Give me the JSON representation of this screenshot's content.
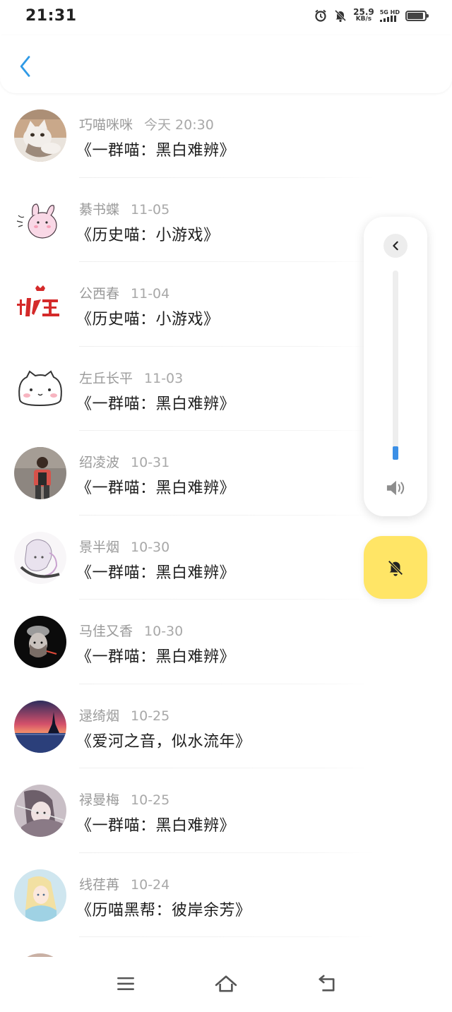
{
  "status_bar": {
    "time": "21:31",
    "net_speed_value": "25.9",
    "net_speed_unit": "KB/s",
    "signal_label": "5G HD",
    "battery_level": 0.9,
    "icons": [
      "alarm-icon",
      "silent-bell-icon",
      "signal-icon",
      "battery-icon"
    ]
  },
  "header": {
    "back_icon": "chevron-left-icon",
    "accent_color": "#2f9ae6"
  },
  "list": {
    "items": [
      {
        "name": "巧喵咪咪",
        "date": "今天 20:30",
        "title": "《一群喵：黑白难辨》",
        "avatar": "cat-photo"
      },
      {
        "name": "綦书蝶",
        "date": "11-05",
        "title": "《历史喵：小游戏》",
        "avatar": "pink-bunny"
      },
      {
        "name": "公西春",
        "date": "11-04",
        "title": "《历史喵：小游戏》",
        "avatar": "red-calligraphy"
      },
      {
        "name": "左丘长平",
        "date": "11-03",
        "title": "《一群喵：黑白难辨》",
        "avatar": "white-cat-cartoon"
      },
      {
        "name": "绍凌波",
        "date": "10-31",
        "title": "《一群喵：黑白难辨》",
        "avatar": "person-photo"
      },
      {
        "name": "景半烟",
        "date": "10-30",
        "title": "《一群喵：黑白难辨》",
        "avatar": "anime-sketch"
      },
      {
        "name": "马佳又香",
        "date": "10-30",
        "title": "《一群喵：黑白难辨》",
        "avatar": "dark-portrait"
      },
      {
        "name": "逯绮烟",
        "date": "10-25",
        "title": "《爱河之音，似水流年》",
        "avatar": "sunset-landscape"
      },
      {
        "name": "禄曼梅",
        "date": "10-25",
        "title": "《一群喵：黑白难辨》",
        "avatar": "anime-girl"
      },
      {
        "name": "线荏苒",
        "date": "10-24",
        "title": "《历喵黑帮：彼岸余芳》",
        "avatar": "anime-princess"
      }
    ]
  },
  "volume_panel": {
    "collapse_icon": "chevron-left-icon",
    "level": 0.07,
    "speaker_icon": "speaker-icon",
    "accent_color": "#3b8fe6"
  },
  "mute_button": {
    "icon": "bell-off-icon",
    "color": "#ffe566"
  },
  "nav_bar": {
    "icons": [
      "menu-icon",
      "home-icon",
      "back-arrow-icon"
    ]
  }
}
